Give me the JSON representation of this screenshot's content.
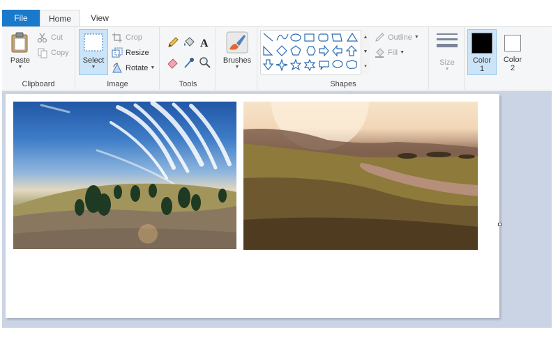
{
  "tabs": {
    "file": "File",
    "home": "Home",
    "view": "View"
  },
  "clipboard": {
    "paste": "Paste",
    "cut": "Cut",
    "copy": "Copy",
    "label": "Clipboard"
  },
  "image": {
    "select": "Select",
    "crop": "Crop",
    "resize": "Resize",
    "rotate": "Rotate",
    "label": "Image"
  },
  "tools": {
    "label": "Tools"
  },
  "brushes": {
    "label": "Brushes"
  },
  "shapes": {
    "outline": "Outline",
    "fill": "Fill",
    "label": "Shapes"
  },
  "size": {
    "label": "Size"
  },
  "colors": {
    "color1_line1": "Color",
    "color1_line2": "1",
    "color2_line1": "Color",
    "color2_line2": "2",
    "color1_value": "#000000",
    "color2_value": "#ffffff"
  },
  "theme": {
    "accent": "#1979ca",
    "ribbon_bg": "#f5f6f7",
    "workspace_bg": "#cbd4e4",
    "selected_bg": "#cce4f7"
  },
  "canvas": {
    "images": [
      {
        "subject": "hill with trees under streaked blue sky"
      },
      {
        "subject": "sunlit field with winding dirt road"
      }
    ]
  }
}
